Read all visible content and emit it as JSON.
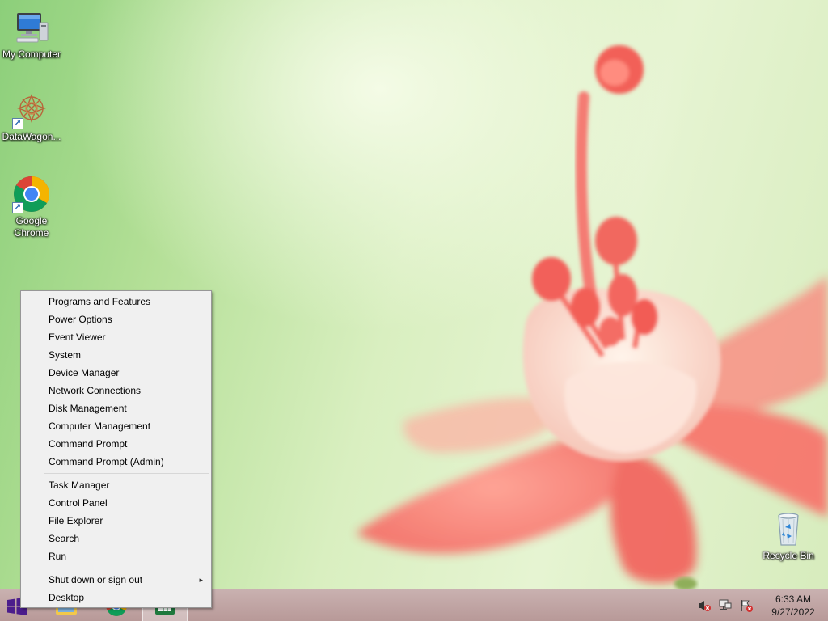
{
  "desktop": {
    "icons": [
      {
        "id": "my-computer",
        "label": "My Computer"
      },
      {
        "id": "datawagon",
        "label": "DataWagon..."
      },
      {
        "id": "google-chrome",
        "label": "Google Chrome"
      },
      {
        "id": "recycle-bin",
        "label": "Recycle Bin"
      }
    ]
  },
  "context_menu": {
    "group1": [
      "Programs and Features",
      "Power Options",
      "Event Viewer",
      "System",
      "Device Manager",
      "Network Connections",
      "Disk Management",
      "Computer Management",
      "Command Prompt",
      "Command Prompt (Admin)"
    ],
    "group2": [
      "Task Manager",
      "Control Panel",
      "File Explorer",
      "Search",
      "Run"
    ],
    "group3": [
      {
        "label": "Shut down or sign out",
        "submenu_arrow": "▸"
      },
      {
        "label": "Desktop"
      }
    ]
  },
  "taskbar": {
    "apps": [
      {
        "name": "file-explorer",
        "icon": "folder-icon"
      },
      {
        "name": "google-chrome",
        "icon": "chrome-icon"
      },
      {
        "name": "spreadsheet",
        "icon": "spreadsheet-icon",
        "active": true
      }
    ],
    "tray": {
      "icons": [
        "volume-muted-icon",
        "network-icon",
        "action-center-flag-icon"
      ],
      "time": "6:33 AM",
      "date": "9/27/2022"
    }
  },
  "colors": {
    "menu_bg": "#f0f0f0",
    "taskbar_bg": "#c2a7a6",
    "start_accent": "#4b1d8c"
  }
}
